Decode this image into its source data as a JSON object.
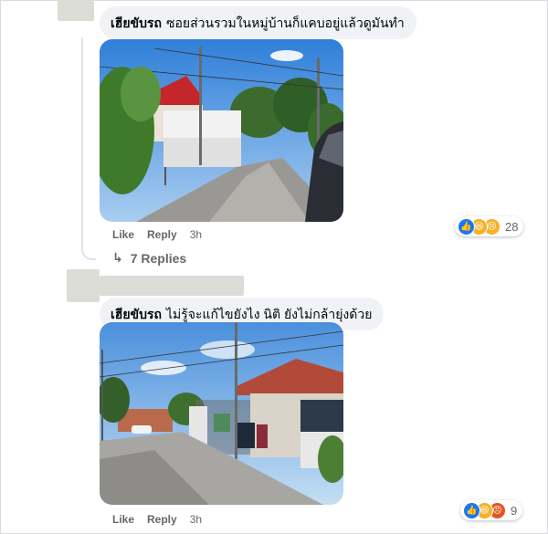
{
  "comments": [
    {
      "author": "เฮียขับรถ",
      "text": "ซอยส่วนรวมในหมู่บ้านก็แคบอยู่แล้วดูมันทำ",
      "actions": {
        "like": "Like",
        "reply": "Reply",
        "time": "3h"
      },
      "reactions": {
        "icons": [
          "like-icon",
          "haha-icon",
          "sad-icon"
        ],
        "count": "28"
      },
      "replies": {
        "arrow": "↳",
        "label": "7 Replies"
      }
    },
    {
      "author": "เฮียขับรถ",
      "text": "ไม่รู้จะแก้ไขยังไง นิติ ยังไม่กล้ายุ่งด้วย",
      "actions": {
        "like": "Like",
        "reply": "Reply",
        "time": "3h"
      },
      "reactions": {
        "icons": [
          "like-icon",
          "haha-icon",
          "angry-icon"
        ],
        "count": "9"
      }
    }
  ],
  "colors": {
    "bubble": "#f0f2f5",
    "meta_text": "#65676b",
    "like_blue": "#1877f2",
    "haha_yellow": "#f7b125",
    "angry_orange": "#e8541f",
    "redaction": "#dcdcd6"
  }
}
